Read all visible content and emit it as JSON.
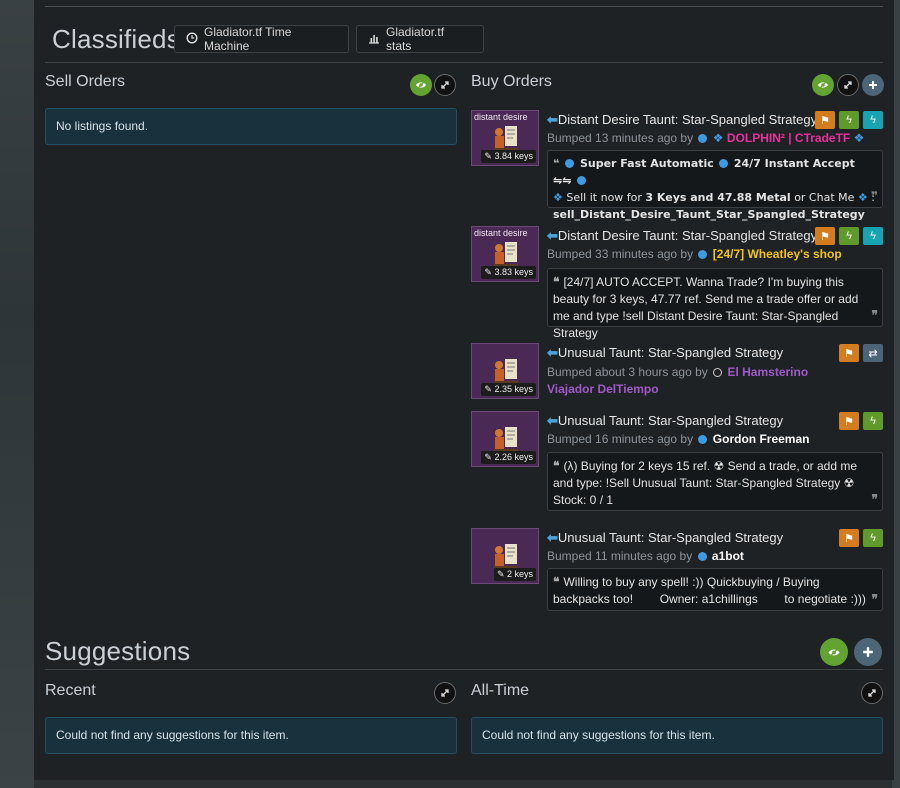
{
  "classifieds": {
    "title": "Classifieds",
    "buttons": [
      {
        "label": "Gladiator.tf Time Machine",
        "icon": "clock-icon"
      },
      {
        "label": "Gladiator.tf stats",
        "icon": "bar-chart-icon"
      }
    ]
  },
  "sell": {
    "heading": "Sell Orders",
    "empty": "No listings found."
  },
  "buy": {
    "heading": "Buy Orders",
    "listings": [
      {
        "caption": "distant desire",
        "price": "3.84 keys",
        "title": "Distant Desire Taunt: Star-Spangled Strategy",
        "bumped": "Bumped 13 minutes ago by",
        "user": "DOLPHIN² | CTradeTF",
        "user_color": "#e8309f",
        "quote_line1": "Super Fast Automatic",
        "quote_line1b": "24/7 Instant Accept ⇋⇋",
        "quote_line2a": "Sell it now for",
        "quote_line2b": "3 Keys and 47.88 Metal",
        "quote_line2c": "or Chat Me",
        "quote_line3": "sell_Distant_Desire_Taunt_Star_Spangled_Strategy"
      },
      {
        "caption": "distant desire",
        "price": "3.83 keys",
        "title": "Distant Desire Taunt: Star-Spangled Strategy",
        "bumped": "Bumped 33 minutes ago by",
        "user": "[24/7] Wheatley's shop",
        "user_color": "#f0c419",
        "quote": "[24/7] AUTO ACCEPT. Wanna Trade? I'm buying this beauty for 3 keys, 47.77 ref. Send me a trade offer or add me and type !sell Distant Desire Taunt: Star-Spangled Strategy"
      },
      {
        "caption": "",
        "price": "2.35 keys",
        "title": "Unusual Taunt: Star-Spangled Strategy",
        "bumped": "Bumped about 3 hours ago by",
        "user": "El Hamsterino Viajador DelTiempo",
        "user_color": "#a05ac8"
      },
      {
        "caption": "",
        "price": "2.26 keys",
        "title": "Unusual Taunt: Star-Spangled Strategy",
        "bumped": "Bumped 16 minutes ago by",
        "user": "Gordon Freeman",
        "user_color": "#ffffff",
        "quote": "(λ) Buying for 2 keys 15 ref. ☢ Send a trade, or add me and type: !Sell Unusual Taunt: Star-Spangled Strategy ☢ Stock: 0 / 1"
      },
      {
        "caption": "",
        "price": "2 keys",
        "title": "Unusual Taunt: Star-Spangled Strategy",
        "bumped": "Bumped 11 minutes ago by",
        "user": "a1bot",
        "user_color": "#ffffff",
        "quote": "Willing to buy any spell! :)) Quickbuying / Buying backpacks too!        Owner: a1chillings        to negotiate :)))"
      }
    ]
  },
  "suggestions": {
    "title": "Suggestions",
    "recent_heading": "Recent",
    "alltime_heading": "All-Time",
    "recent_empty": "Could not find any suggestions for this item.",
    "alltime_empty": "Could not find any suggestions for this item."
  }
}
